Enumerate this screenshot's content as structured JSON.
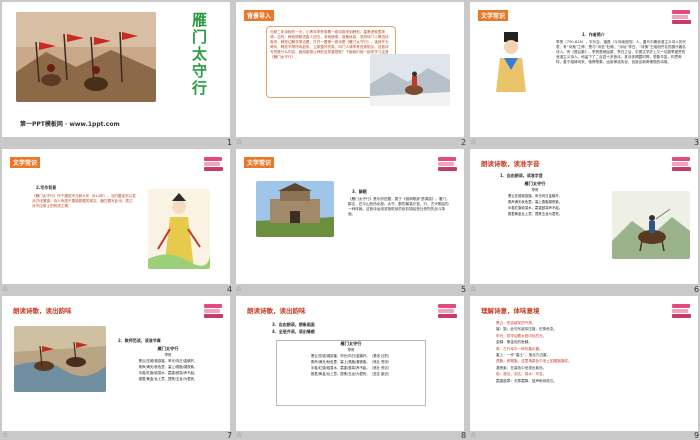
{
  "slide1": {
    "title_chars": [
      "雁",
      "门",
      "太",
      "守",
      "行"
    ],
    "footer": "第一PPT模板网 · www.1ppt.com",
    "number": "1"
  },
  "slide2": {
    "tag": "背景导入",
    "text": "元和二年深秋的一天，小青年李贺带着一卷诗卷来到韩愈、皇甫湜家里拜谒，当时，韩愈刚刚送客人回去，非常疲倦，准备休息。忽然侍门人捧进诗卷来，韩愈边解衣带边看，打开一看第一首诗是《雁门太守行》，读到开头两句，韩愈不禁惊叫起来，立即整好衣带，叫门人请李贺进来相见。这首诗写的是什么内容，竟然能够让韩愈这样重视呢？下面我们就一起来学习这首《雁门太守行》。",
    "number": "2"
  },
  "slide3": {
    "tag": "文学常识",
    "heading": "1．作者简介",
    "text": "李贺（790-816），字长吉，福昌（今河南宜阳）人，唐代中期浪漫主义诗人的代表，有“诗鬼”之称，是与“诗圣”杜甫、“诗仙”李白、“诗佛”王维相齐名的唐代著名诗人。有《昌谷集》。李贺是继屈原、李白之后，中国文学史上又一位颇享盛誉的浪漫主义诗人。他留下了二百四十多首诗，其诗多揭露时弊，想象丰富，构思奇特，善于熔铸词采，驰骋想象，运用神话传说，创造出新奇瑰丽的诗境。",
    "number": "3"
  },
  "slide4": {
    "tag": "文学常识",
    "heading": "2.写作背景",
    "text": "《雁门太守行》作于唐宪宗元和九年（814年），当时唐宪宗以发兵讨伐藩镇，诗人有感于藩镇割据的现实，藉古题写此诗，表达对守边将士的赞颂之情。",
    "number": "4"
  },
  "slide5": {
    "tag": "文学常识",
    "heading": "3．解题",
    "text": "《雁门太守行》是乐府旧题，属于《相和歌辞·瑟调曲》。雁门，郡名，在今山西西北部。太守，郡的最高长官。行，古代歌曲的一种体裁。这首诗运用浓艳斑驳的色彩描绘悲壮惨烈的战斗场面。",
    "number": "5"
  },
  "slide6": {
    "tag": "朗读诗歌，读准字音",
    "heading": "1．自由朗读，读准字音",
    "poem_title": "雁门太守行",
    "poem_author": "李贺",
    "lines": [
      "黑云压城城欲摧，甲光向日金鳞开。",
      "角声满天秋色里，塞上燕脂凝夜紫。",
      "半卷红旗临易水，霜重鼓寒声不起。",
      "报君黄金台上意，提携玉龙为君死。"
    ],
    "number": "6"
  },
  "slide7": {
    "tag": "朗读诗歌，读出韵味",
    "heading": "2．教师范读，读准节奏",
    "poem_title": "雁门太守行",
    "poem_author": "李贺",
    "lines": [
      "黑云/压城/城欲摧，甲光/向日/金鳞开。",
      "角声/满天/秋色里，塞上/燕脂/凝夜紫。",
      "半卷/红旗/临易水，霜重/鼓寒/声不起。",
      "报君/黄金/台上意，提携/玉龙/为君死。"
    ],
    "number": "7"
  },
  "slide8": {
    "tag": "朗读诗歌，读出韵味",
    "heading1": "3．自由朗读，想象画面",
    "heading2": "4．全班齐读，读出情感",
    "poem_title": "雁门太守行",
    "poem_author": "李贺",
    "lines": [
      "黑云/压城/城欲摧，甲光/向日/金鳞开。（紧张 壮烈）",
      "角声/满天/秋色里，塞上/燕脂/凝夜紫。（悲壮 苍凉）",
      "半卷/红旗/临易水，霜重/鼓寒/声不起。（悲壮 低沉）",
      "报君/黄金/台上意，提携/玉龙/为君死。（坚定 豪迈）"
    ],
    "number": "8"
  },
  "slide9": {
    "tag": "理解诗意，体味意境",
    "lines": [
      "黑云：形容敌军的气势。",
      "摧：毁。此句写敌军压境，形势危急。",
      "甲光：铠甲迎着太阳闪出的光。",
      "金鳞：像金色的鱼鳞。",
      "角：古代军中一种吹奏乐器。",
      "塞上：一作“塞土”，指北方边塞。",
      "燕脂：即胭脂，这里指暮色中泥土如胭脂凝成。",
      "凝夜紫：在暮色中呈现出紫色。",
      "临：逼近，到达。易水：河名。",
      "霜重鼓寒：天寒霜降，鼓声郁闷低沉。"
    ],
    "number": "9"
  }
}
